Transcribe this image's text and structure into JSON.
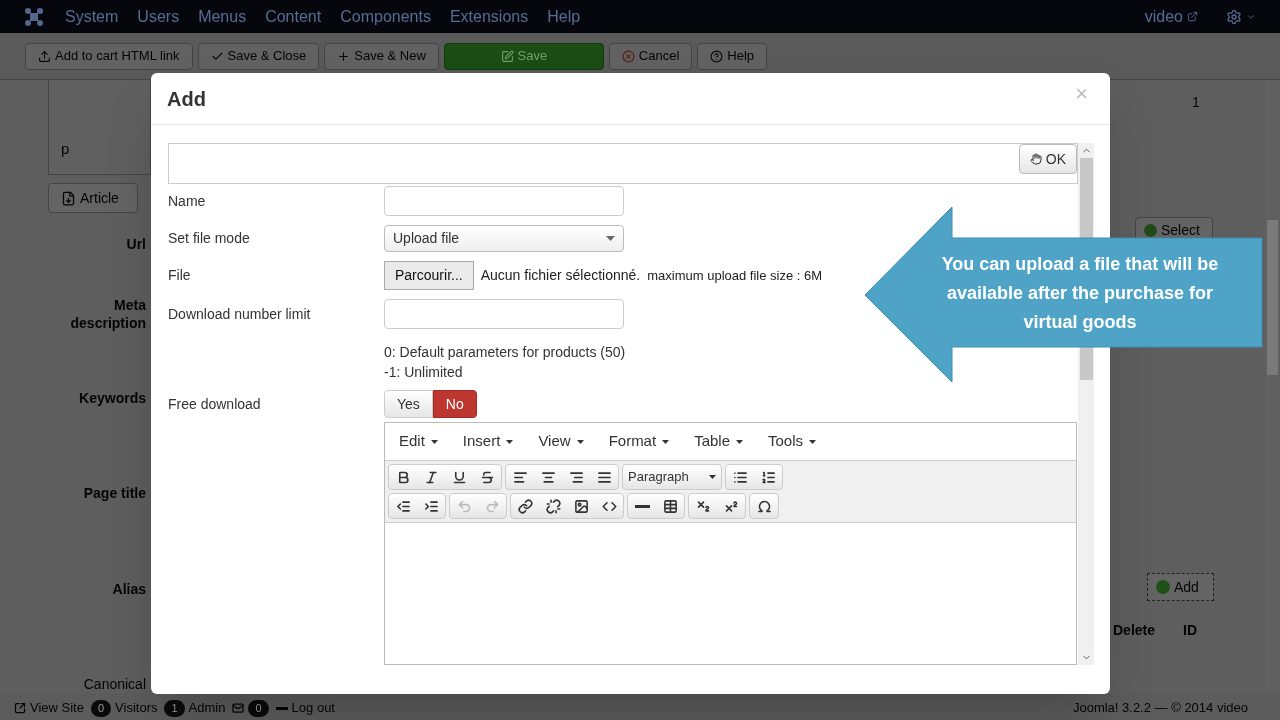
{
  "nav": {
    "menu": [
      "System",
      "Users",
      "Menus",
      "Content",
      "Components",
      "Extensions",
      "Help"
    ],
    "user": "video"
  },
  "toolbar": [
    {
      "label": "Add to cart HTML link",
      "kind": "upload"
    },
    {
      "label": "Save & Close",
      "kind": "check"
    },
    {
      "label": "Save & New",
      "kind": "plus"
    },
    {
      "label": "Save",
      "kind": "save"
    },
    {
      "label": "Cancel",
      "kind": "cancel"
    },
    {
      "label": "Help",
      "kind": "help"
    }
  ],
  "background": {
    "p_label": "p",
    "article_button": "Article",
    "field_labels": [
      "Url",
      "Meta description",
      "Keywords",
      "Page title",
      "Alias",
      "Canonical"
    ],
    "count": "1",
    "select_button": "Select",
    "add_button": "Add",
    "columns": [
      "Delete",
      "ID"
    ]
  },
  "modal": {
    "title": "Add",
    "close": "×",
    "ok_button": "OK",
    "fields": [
      {
        "kind": "text",
        "label": "Name"
      },
      {
        "kind": "select",
        "label": "Set file mode",
        "value": "Upload file"
      },
      {
        "kind": "file",
        "label": "File",
        "button": "Parcourir...",
        "status": "Aucun fichier sélectionné.",
        "note": "maximum upload file size : 6M"
      },
      {
        "kind": "text",
        "label": "Download number limit",
        "help": [
          "0: Default parameters for products (50)",
          "-1: Unlimited"
        ]
      },
      {
        "kind": "toggle",
        "label": "Free download",
        "options": [
          {
            "label": "Yes",
            "selected": false
          },
          {
            "label": "No",
            "selected": true
          }
        ]
      }
    ],
    "editor": {
      "menus": [
        "Edit",
        "Insert",
        "View",
        "Format",
        "Table",
        "Tools"
      ],
      "format_select": "Paragraph"
    }
  },
  "callout": "You can upload a file that will be available after the purchase for virtual goods",
  "status_bar": {
    "items": [
      {
        "kind": "site",
        "label": "View Site"
      },
      {
        "kind": "count",
        "count": "0",
        "label": "Visitors"
      },
      {
        "kind": "count",
        "count": "1",
        "label": "Admin"
      },
      {
        "kind": "mail",
        "count": "0"
      },
      {
        "kind": "logout",
        "label": "Log out"
      }
    ],
    "version": "Joomla! 3.2.2 — © 2014 video"
  }
}
